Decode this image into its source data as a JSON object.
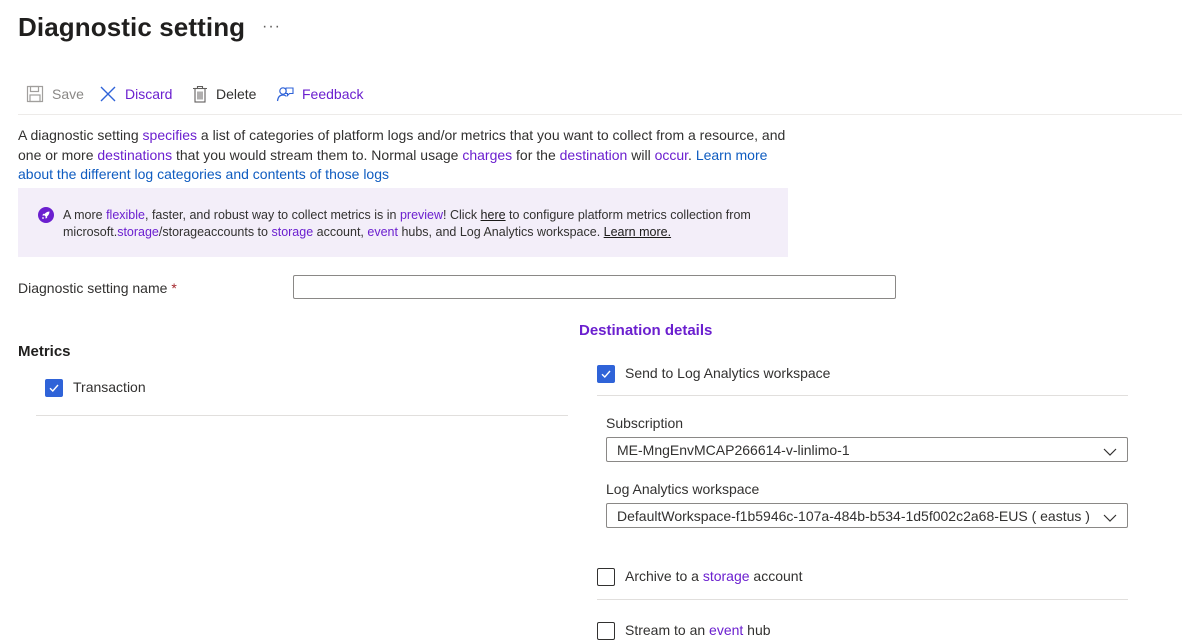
{
  "header": {
    "title": "Diagnostic setting",
    "more_label": "···"
  },
  "toolbar": {
    "save_label": "Save",
    "discard_label": "Discard",
    "delete_label": "Delete",
    "feedback_label": "Feedback"
  },
  "description": {
    "p1": "A diagnostic setting ",
    "w_specifies": "specifies",
    "p2": " a list of categories of platform logs and/or metrics that you want to collect from a resource, and one or more ",
    "w_destinations": "destinations",
    "p3": " that you would stream them to. Normal usage ",
    "w_charges": "charges",
    "p4": " for the ",
    "w_destination": "destination",
    "p5": " will ",
    "w_occur": "occur",
    "p6": ". ",
    "learn_more_link": "Learn more about the different log categories and contents of those logs"
  },
  "banner": {
    "t1": "A more ",
    "w_flexible": "flexible",
    "t2": ", faster, and robust way to collect metrics is in ",
    "w_preview": "preview",
    "t3": "! Click ",
    "here_link": "here",
    "t4": " to configure platform metrics collection from microsoft.",
    "w_storage": "storage",
    "t5": "/storageaccounts to ",
    "w_storage2": "storage",
    "t6": " account, ",
    "w_event": "event",
    "t7": " hubs, and Log Analytics workspace. ",
    "learn_more_link": "Learn more."
  },
  "form": {
    "name_label": "Diagnostic setting name",
    "required_marker": "*",
    "name_value": ""
  },
  "metrics": {
    "heading": "Metrics",
    "items": [
      {
        "label": "Transaction",
        "checked": true
      }
    ]
  },
  "destination": {
    "heading": "Destination details",
    "log_analytics": {
      "label": "Send to Log Analytics workspace",
      "checked": true,
      "subscription_label": "Subscription",
      "subscription_value": "ME-MngEnvMCAP266614-v-linlimo-1",
      "workspace_label": "Log Analytics workspace",
      "workspace_value": "DefaultWorkspace-f1b5946c-107a-484b-b534-1d5f002c2a68-EUS ( eastus )"
    },
    "archive": {
      "t1": "Archive to a ",
      "w_storage": "storage",
      "t2": " account",
      "checked": false
    },
    "stream": {
      "t1": "Stream to an ",
      "w_event": "event",
      "t2": " hub",
      "checked": false
    }
  },
  "colors": {
    "accent_purple": "#6b1fcf",
    "link_blue": "#0f5cc0",
    "checkbox_blue": "#2f63d8",
    "banner_bg": "#f3eef9"
  },
  "icons": {
    "save": "save-icon",
    "discard": "close-icon",
    "delete": "trash-icon",
    "feedback": "feedback-icon",
    "banner": "rocket-icon",
    "dropdown": "chevron-down-icon"
  }
}
